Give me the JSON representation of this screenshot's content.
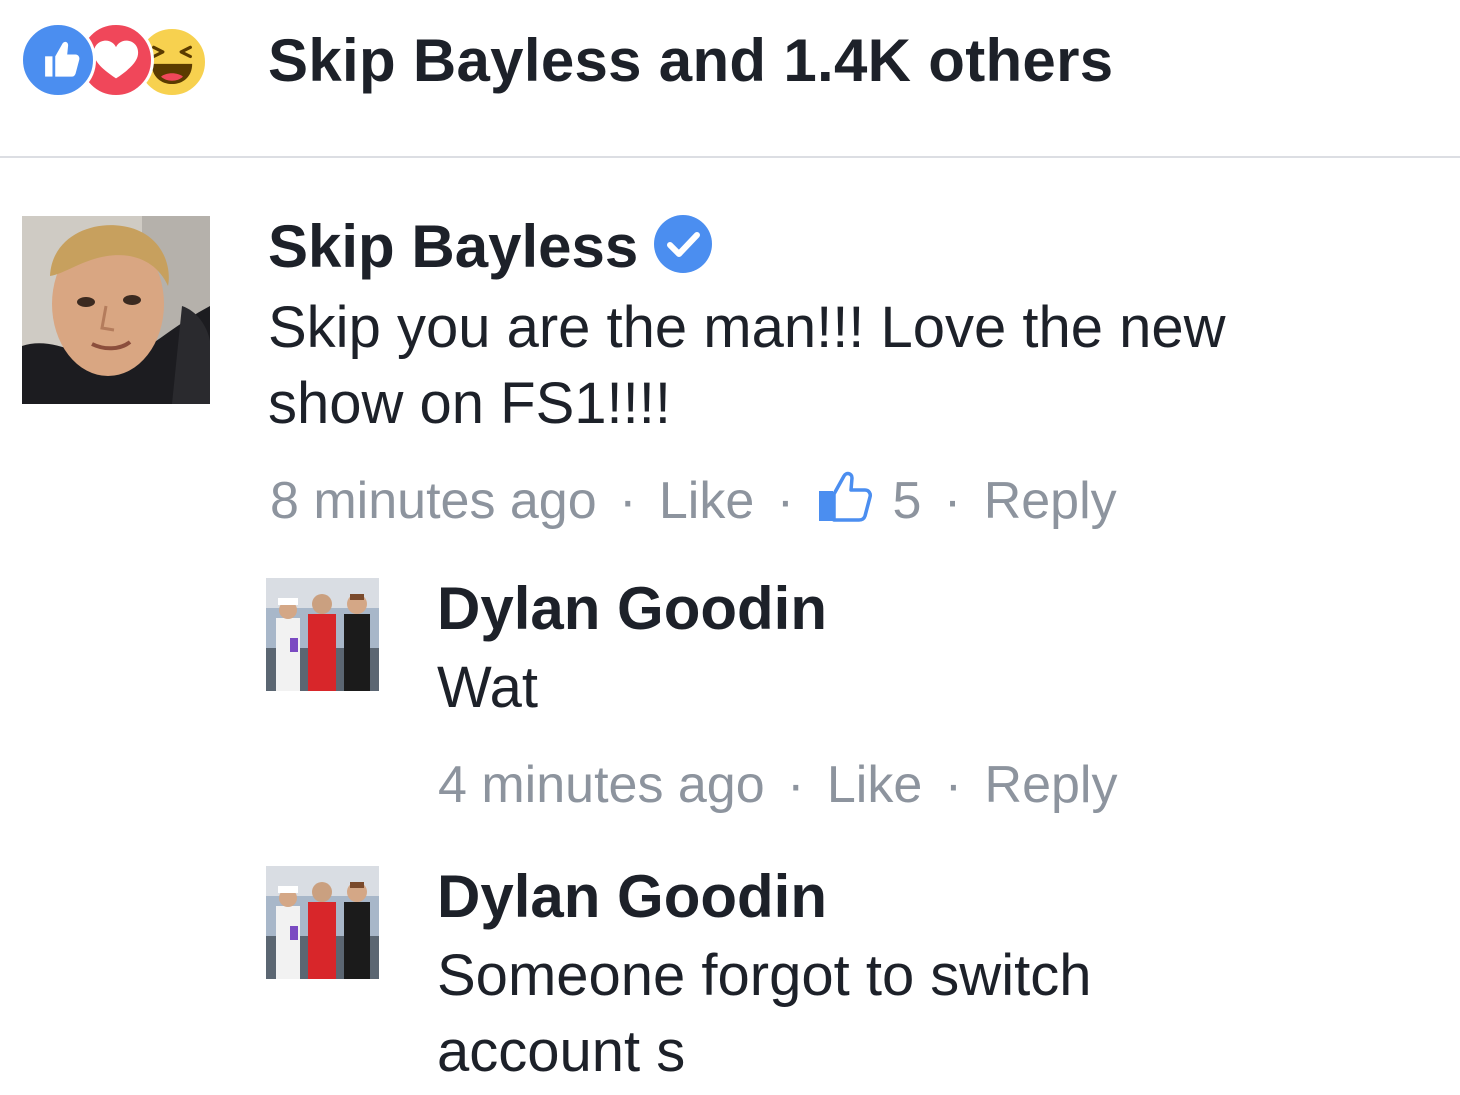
{
  "reactions": {
    "icons": [
      "like-icon",
      "love-icon",
      "haha-icon"
    ],
    "summary": "Skip Bayless and 1.4K others",
    "colors": {
      "like": "#4b8ef0",
      "love": "#f0475a",
      "haha": "#f7d14f"
    }
  },
  "comments": [
    {
      "author": "Skip Bayless",
      "verified": true,
      "lines": [
        "Skip you are the man!!! Love the new",
        "show on FS1!!!!"
      ],
      "time": "8 minutes ago",
      "like_label": "Like",
      "like_count": "5",
      "reply_label": "Reply",
      "separator": "·"
    },
    {
      "author": "Dylan Goodin",
      "lines": [
        "Wat"
      ],
      "time": "4 minutes ago",
      "like_label": "Like",
      "reply_label": "Reply",
      "separator": "·"
    },
    {
      "author": "Dylan Goodin",
      "lines": [
        "Someone forgot to switch",
        "account s"
      ]
    }
  ],
  "colors": {
    "text": "#1d2129",
    "meta": "#8d949e",
    "verified": "#4b8ef0",
    "divider": "#dcdee3"
  }
}
